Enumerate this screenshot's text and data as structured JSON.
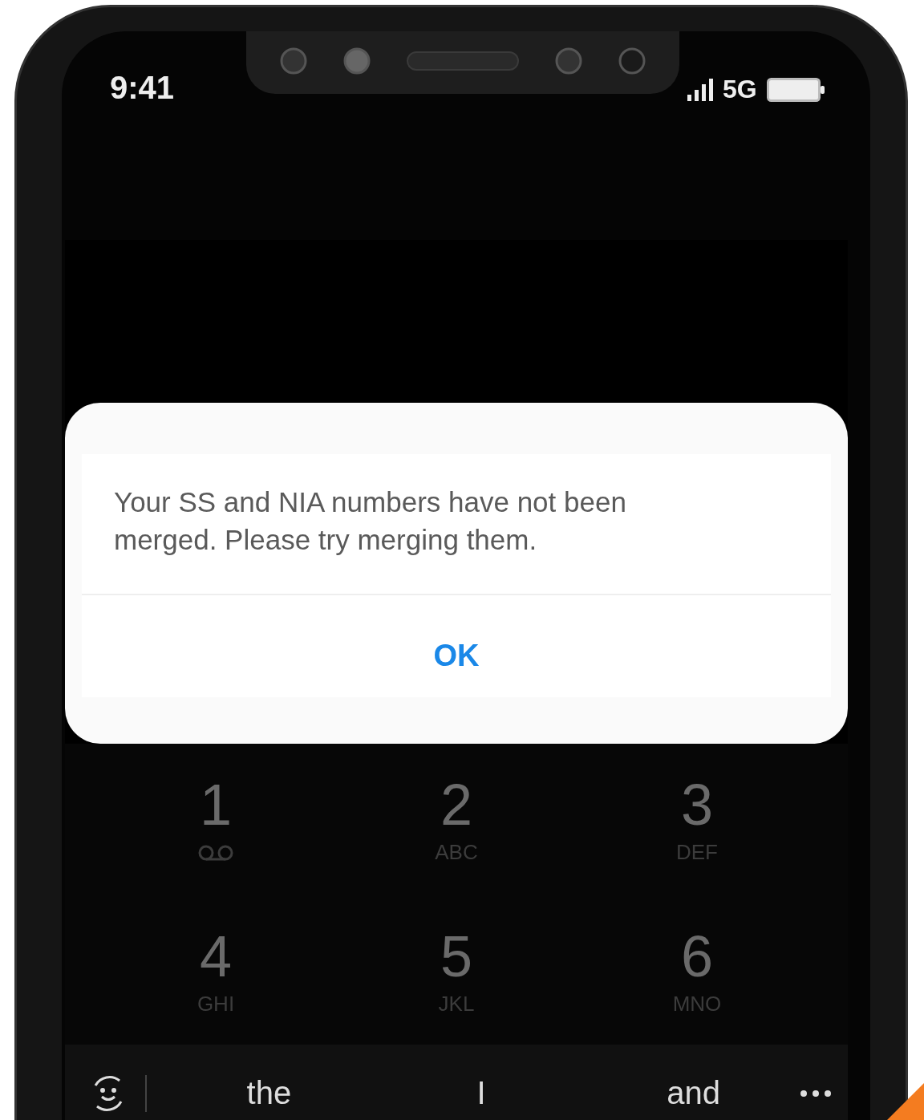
{
  "status_bar": {
    "time": "9:41",
    "network": "5G"
  },
  "dialog": {
    "message": "Your SS and NIA numbers have not been merged. Please try merging them.",
    "button": "OK"
  },
  "keypad": [
    {
      "kind": "voicemail",
      "digit": "1"
    },
    {
      "kind": "letters",
      "digit": "2",
      "letters": "ABC"
    },
    {
      "kind": "letters",
      "digit": "3",
      "letters": "DEF"
    },
    {
      "kind": "letters",
      "digit": "4",
      "letters": "GHI"
    },
    {
      "kind": "letters",
      "digit": "5",
      "letters": "JKL"
    },
    {
      "kind": "letters",
      "digit": "6",
      "letters": "MNO"
    }
  ],
  "suggestions": [
    "the",
    "I",
    "and"
  ]
}
